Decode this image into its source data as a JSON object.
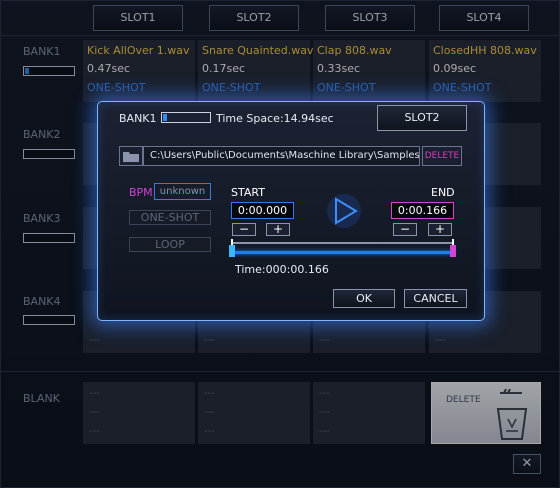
{
  "slots": [
    "SLOT1",
    "SLOT2",
    "SLOT3",
    "SLOT4"
  ],
  "banks": [
    "BANK1",
    "BANK2",
    "BANK3",
    "BANK4"
  ],
  "bank1_meter_level": 0.08,
  "bank1_cells": [
    {
      "name": "Kick AllOver 1.wav",
      "time": "0.47sec",
      "mode": "ONE-SHOT"
    },
    {
      "name": "Snare Quainted.wav",
      "time": "0.17sec",
      "mode": "ONE-SHOT"
    },
    {
      "name": "Clap 808.wav",
      "time": "0.33sec",
      "mode": "ONE-SHOT"
    },
    {
      "name": "ClosedHH 808.wav",
      "time": "0.09sec",
      "mode": "ONE-SHOT"
    }
  ],
  "empty_text": "---",
  "blank_label": "BLANK",
  "delete_label": "DELETE",
  "close_glyph": "✕",
  "dialog": {
    "bank": "BANK1",
    "time_space": "Time Space:14.94sec",
    "slot": "SLOT2",
    "path": "C:\\Users\\Public\\Documents\\Maschine Library\\Samples\\Drums\\...",
    "delete": "DELETE",
    "bpm_label": "BPM",
    "bpm_value": "unknown",
    "one_shot": "ONE-SHOT",
    "loop": "LOOP",
    "start_label": "START",
    "end_label": "END",
    "start_value": "0:00.000",
    "end_value": "0:00.166",
    "minus": "−",
    "plus": "+",
    "time": "Time:000:00.166",
    "ok": "OK",
    "cancel": "CANCEL"
  },
  "colors": {
    "accent_blue": "#2f8cff",
    "file_name": "#ffd24a",
    "magenta": "#d044d6"
  },
  "icons": [
    "folder-icon",
    "play-icon",
    "trash-icon",
    "close-icon"
  ]
}
